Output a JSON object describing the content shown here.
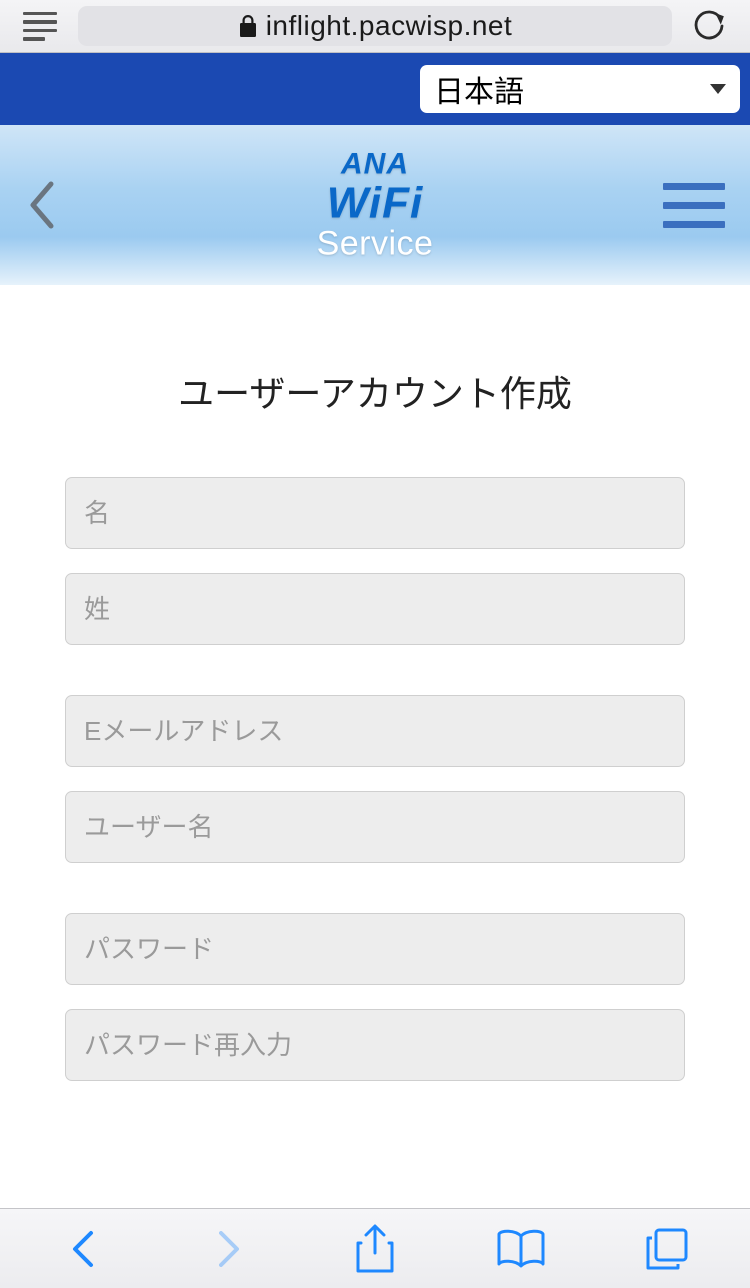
{
  "browser": {
    "url": "inflight.pacwisp.net"
  },
  "langBar": {
    "selected": "日本語"
  },
  "logo": {
    "line1": "ANA",
    "line2": "WiFi",
    "line3": "Service"
  },
  "page": {
    "title": "ユーザーアカウント作成"
  },
  "form": {
    "groups": [
      {
        "fields": [
          {
            "placeholder": "名"
          },
          {
            "placeholder": "姓"
          }
        ]
      },
      {
        "fields": [
          {
            "placeholder": "Eメールアドレス"
          },
          {
            "placeholder": "ユーザー名"
          }
        ]
      },
      {
        "fields": [
          {
            "placeholder": "パスワード"
          },
          {
            "placeholder": "パスワード再入力"
          }
        ]
      }
    ]
  }
}
